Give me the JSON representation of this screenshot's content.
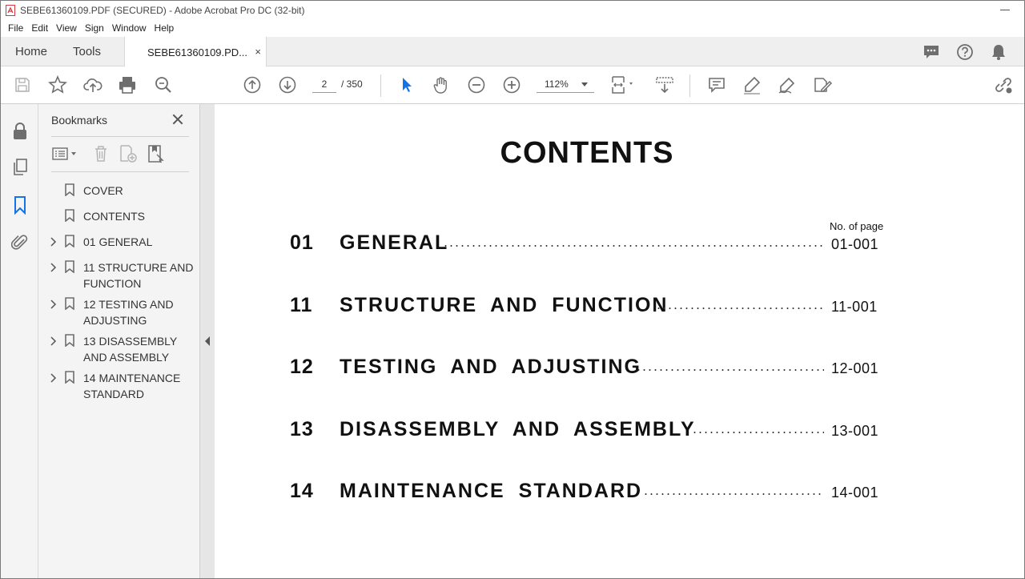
{
  "window": {
    "title": "SEBE61360109.PDF (SECURED) - Adobe Acrobat Pro DC (32-bit)"
  },
  "menu": [
    "File",
    "Edit",
    "View",
    "Sign",
    "Window",
    "Help"
  ],
  "tabs": {
    "home": "Home",
    "tools": "Tools",
    "document": "SEBE61360109.PD...",
    "close": "×"
  },
  "toolbar": {
    "page_current": "2",
    "page_total": "/ 350",
    "zoom": "112%"
  },
  "bookmarks": {
    "title": "Bookmarks",
    "items": [
      {
        "label": "COVER",
        "expandable": false
      },
      {
        "label": "CONTENTS",
        "expandable": false
      },
      {
        "label": "01 GENERAL",
        "expandable": true
      },
      {
        "label": "11 STRUCTURE AND FUNCTION",
        "expandable": true
      },
      {
        "label": "12 TESTING AND ADJUSTING",
        "expandable": true
      },
      {
        "label": "13 DISASSEMBLY AND ASSEMBLY",
        "expandable": true
      },
      {
        "label": "14 MAINTENANCE STANDARD",
        "expandable": true
      }
    ]
  },
  "document": {
    "title": "CONTENTS",
    "page_column_header": "No. of page",
    "entries": [
      {
        "num": "01",
        "title": "GENERAL",
        "page": "01-001"
      },
      {
        "num": "11",
        "title": "STRUCTURE AND FUNCTION",
        "page": "11-001"
      },
      {
        "num": "12",
        "title": "TESTING AND ADJUSTING",
        "page": "12-001"
      },
      {
        "num": "13",
        "title": "DISASSEMBLY AND ASSEMBLY",
        "page": "13-001"
      },
      {
        "num": "14",
        "title": "MAINTENANCE STANDARD",
        "page": "14-001"
      }
    ]
  },
  "colors": {
    "accent_blue": "#1473e6",
    "pdf_red": "#d7373f",
    "icon_gray": "#6e6e6e"
  }
}
